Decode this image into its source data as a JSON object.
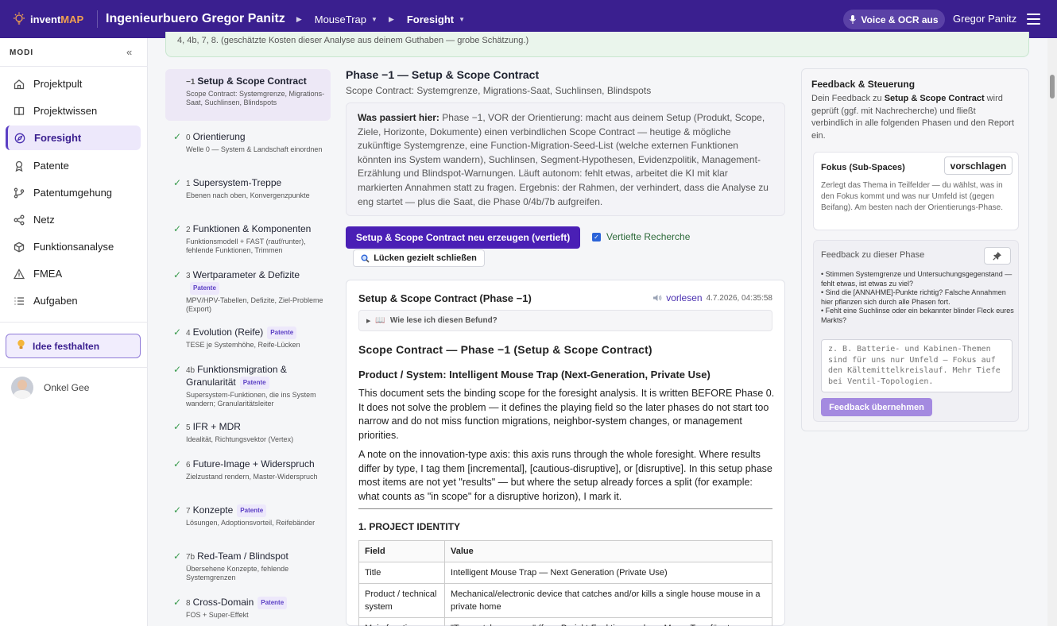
{
  "header": {
    "logo_invent": "invent",
    "logo_map": "MAP",
    "company": "Ingenieurbuero Gregor Panitz",
    "crumbs": [
      "MouseTrap",
      "Foresight"
    ],
    "voice_button": "Voice & OCR aus",
    "user_name": "Gregor Panitz"
  },
  "sidebar": {
    "section_label": "MODI",
    "collapse_glyph": "«",
    "items": [
      {
        "label": "Projektpult",
        "icon": "home-icon"
      },
      {
        "label": "Projektwissen",
        "icon": "book-icon"
      },
      {
        "label": "Foresight",
        "icon": "compass-icon",
        "active": true
      },
      {
        "label": "Patente",
        "icon": "ribbon-icon"
      },
      {
        "label": "Patentumgehung",
        "icon": "branch-icon"
      },
      {
        "label": "Netz",
        "icon": "share-icon"
      },
      {
        "label": "Funktionsanalyse",
        "icon": "cube-icon"
      },
      {
        "label": "FMEA",
        "icon": "warning-icon"
      },
      {
        "label": "Aufgaben",
        "icon": "list-icon"
      }
    ],
    "idea_button": "Idee festhalten",
    "account_name": "Onkel Gee"
  },
  "banner": {
    "text": "4, 4b, 7, 8. (geschätzte Kosten dieser Analyse aus deinem Guthaben — grobe Schätzung.)"
  },
  "phases": [
    {
      "num": "−1",
      "title": "Setup & Scope Contract",
      "sub": "Scope Contract: Systemgrenze, Migrations-Saat, Suchlinsen, Blindspots",
      "selected": true
    },
    {
      "num": "0",
      "title": "Orientierung",
      "sub": "Welle 0 — System & Landschaft einordnen",
      "done": true
    },
    {
      "num": "1",
      "title": "Supersystem-Treppe",
      "sub": "Ebenen nach oben, Konvergenzpunkte",
      "done": true
    },
    {
      "num": "2",
      "title": "Funktionen & Komponenten",
      "sub": "Funktionsmodell + FAST (rauf/runter), fehlende Funktionen, Trimmen",
      "done": true
    },
    {
      "num": "3",
      "title": "Wertparameter & Defizite",
      "badge": "Patente",
      "sub": "MPV/HPV-Tabellen, Defizite, Ziel-Probleme (Export)",
      "done": true
    },
    {
      "num": "4",
      "title": "Evolution (Reife)",
      "badge": "Patente",
      "sub": "TESE je Systemhöhe, Reife-Lücken",
      "done": true
    },
    {
      "num": "4b",
      "title": "Funktionsmigration & Granularität",
      "badge": "Patente",
      "sub": "Supersystem-Funktionen, die ins System wandern; Granularitätsleiter",
      "done": true
    },
    {
      "num": "5",
      "title": "IFR + MDR",
      "sub": "Idealität, Richtungsvektor (Vertex)",
      "done": true
    },
    {
      "num": "6",
      "title": "Future-Image + Widerspruch",
      "sub": "Zielzustand rendern, Master-Widerspruch",
      "done": true
    },
    {
      "num": "7",
      "title": "Konzepte",
      "badge": "Patente",
      "sub": "Lösungen, Adoptionsvorteil, Reifebänder",
      "done": true
    },
    {
      "num": "7b",
      "title": "Red-Team / Blindspot",
      "sub": "Übersehene Konzepte, fehlende Systemgrenzen",
      "done": true
    },
    {
      "num": "8",
      "title": "Cross-Domain",
      "badge": "Patente",
      "sub": "FOS + Super-Effekt",
      "done": true
    }
  ],
  "main": {
    "title": "Phase −1 — Setup & Scope Contract",
    "subtitle": "Scope Contract: Systemgrenze, Migrations-Saat, Suchlinsen, Blindspots",
    "info_label": "Was passiert hier:",
    "info_text": " Phase −1, VOR der Orientierung: macht aus deinem Setup (Produkt, Scope, Ziele, Horizonte, Dokumente) einen verbindlichen Scope Contract — heutige & mögliche zukünftige Systemgrenze, eine Function-Migration-Seed-List (welche externen Funktionen könnten ins System wandern), Suchlinsen, Segment-Hypothesen, Evidenzpolitik, Management-Erzählung und Blindspot-Warnungen. Läuft autonom: fehlt etwas, arbeitet die KI mit klar markierten Annahmen statt zu fragen. Ergebnis: der Rahmen, der verhindert, dass die Analyse zu eng startet — plus die Saat, die Phase 0/4b/7b aufgreifen.",
    "regen_button": "Setup & Scope Contract neu erzeugen (vertieft)",
    "deep_research_label": "Vertiefte Recherche",
    "gap_button": "Lücken gezielt schließen"
  },
  "result": {
    "title": "Setup & Scope Contract (Phase −1)",
    "read_aloud": "vorlesen",
    "timestamp": "4.7.2026, 04:35:58",
    "details_label": "Wie lese ich diesen Befund?",
    "heading1": "Scope Contract — Phase −1 (Setup & Scope Contract)",
    "heading2": "Product / System: Intelligent Mouse Trap (Next-Generation, Private Use)",
    "para1": "This document sets the binding scope for the foresight analysis. It is written BEFORE Phase 0. It does not solve the problem — it defines the playing field so the later phases do not start too narrow and do not miss function migrations, neighbor-system changes, or management priorities.",
    "para2": "A note on the innovation-type axis: this axis runs through the whole foresight. Where results differ by type, I tag them [incremental], [cautious-disruptive], or [disruptive]. In this setup phase most items are not yet \"results\" — but where the setup already forces a split (for example: what counts as \"in scope\" for a disruptive horizon), I mark it.",
    "section1": "1. PROJECT IDENTITY",
    "table_headers": [
      "Field",
      "Value"
    ],
    "table_rows": [
      [
        "Title",
        "Intelligent Mouse Trap — Next Generation (Private Use)"
      ],
      [
        "Product / technical system",
        "Mechanical/electronic device that catches and/or kills a single house mouse in a private home"
      ],
      [
        "Main function",
        "\"Trap catches mouse\" (from Projekt-Funktionsanalyse: MouseTrap fängt"
      ]
    ]
  },
  "feedback": {
    "title": "Feedback & Steuerung",
    "intro_pre": "Dein Feedback zu ",
    "intro_bold": "Setup & Scope Contract",
    "intro_post": " wird geprüft (ggf. mit Nachrecherche) und fließt verbindlich in alle folgenden Phasen und den Report ein.",
    "focus_title": "Fokus (Sub-Spaces)",
    "focus_button": "vorschlagen",
    "focus_desc": "Zerlegt das Thema in Teilfelder — du wählst, was in den Fokus kommt und was nur Umfeld ist (gegen Beifang). Am besten nach der Orientierungs-Phase.",
    "phase_feedback_label": "Feedback zu dieser Phase",
    "hints": [
      "• Stimmen Systemgrenze und Untersuchungsgegenstand — fehlt etwas, ist etwas zu viel?",
      "• Sind die [ANNAHME]-Punkte richtig? Falsche Annahmen hier pflanzen sich durch alle Phasen fort.",
      "• Fehlt eine Suchlinse oder ein bekannter blinder Fleck eures Markts?"
    ],
    "placeholder": "z. B. Batterie- und Kabinen-Themen sind für uns nur Umfeld — Fokus auf den Kältemittelkreislauf. Mehr Tiefe bei Ventil-Topologien.",
    "submit_button": "Feedback übernehmen"
  }
}
